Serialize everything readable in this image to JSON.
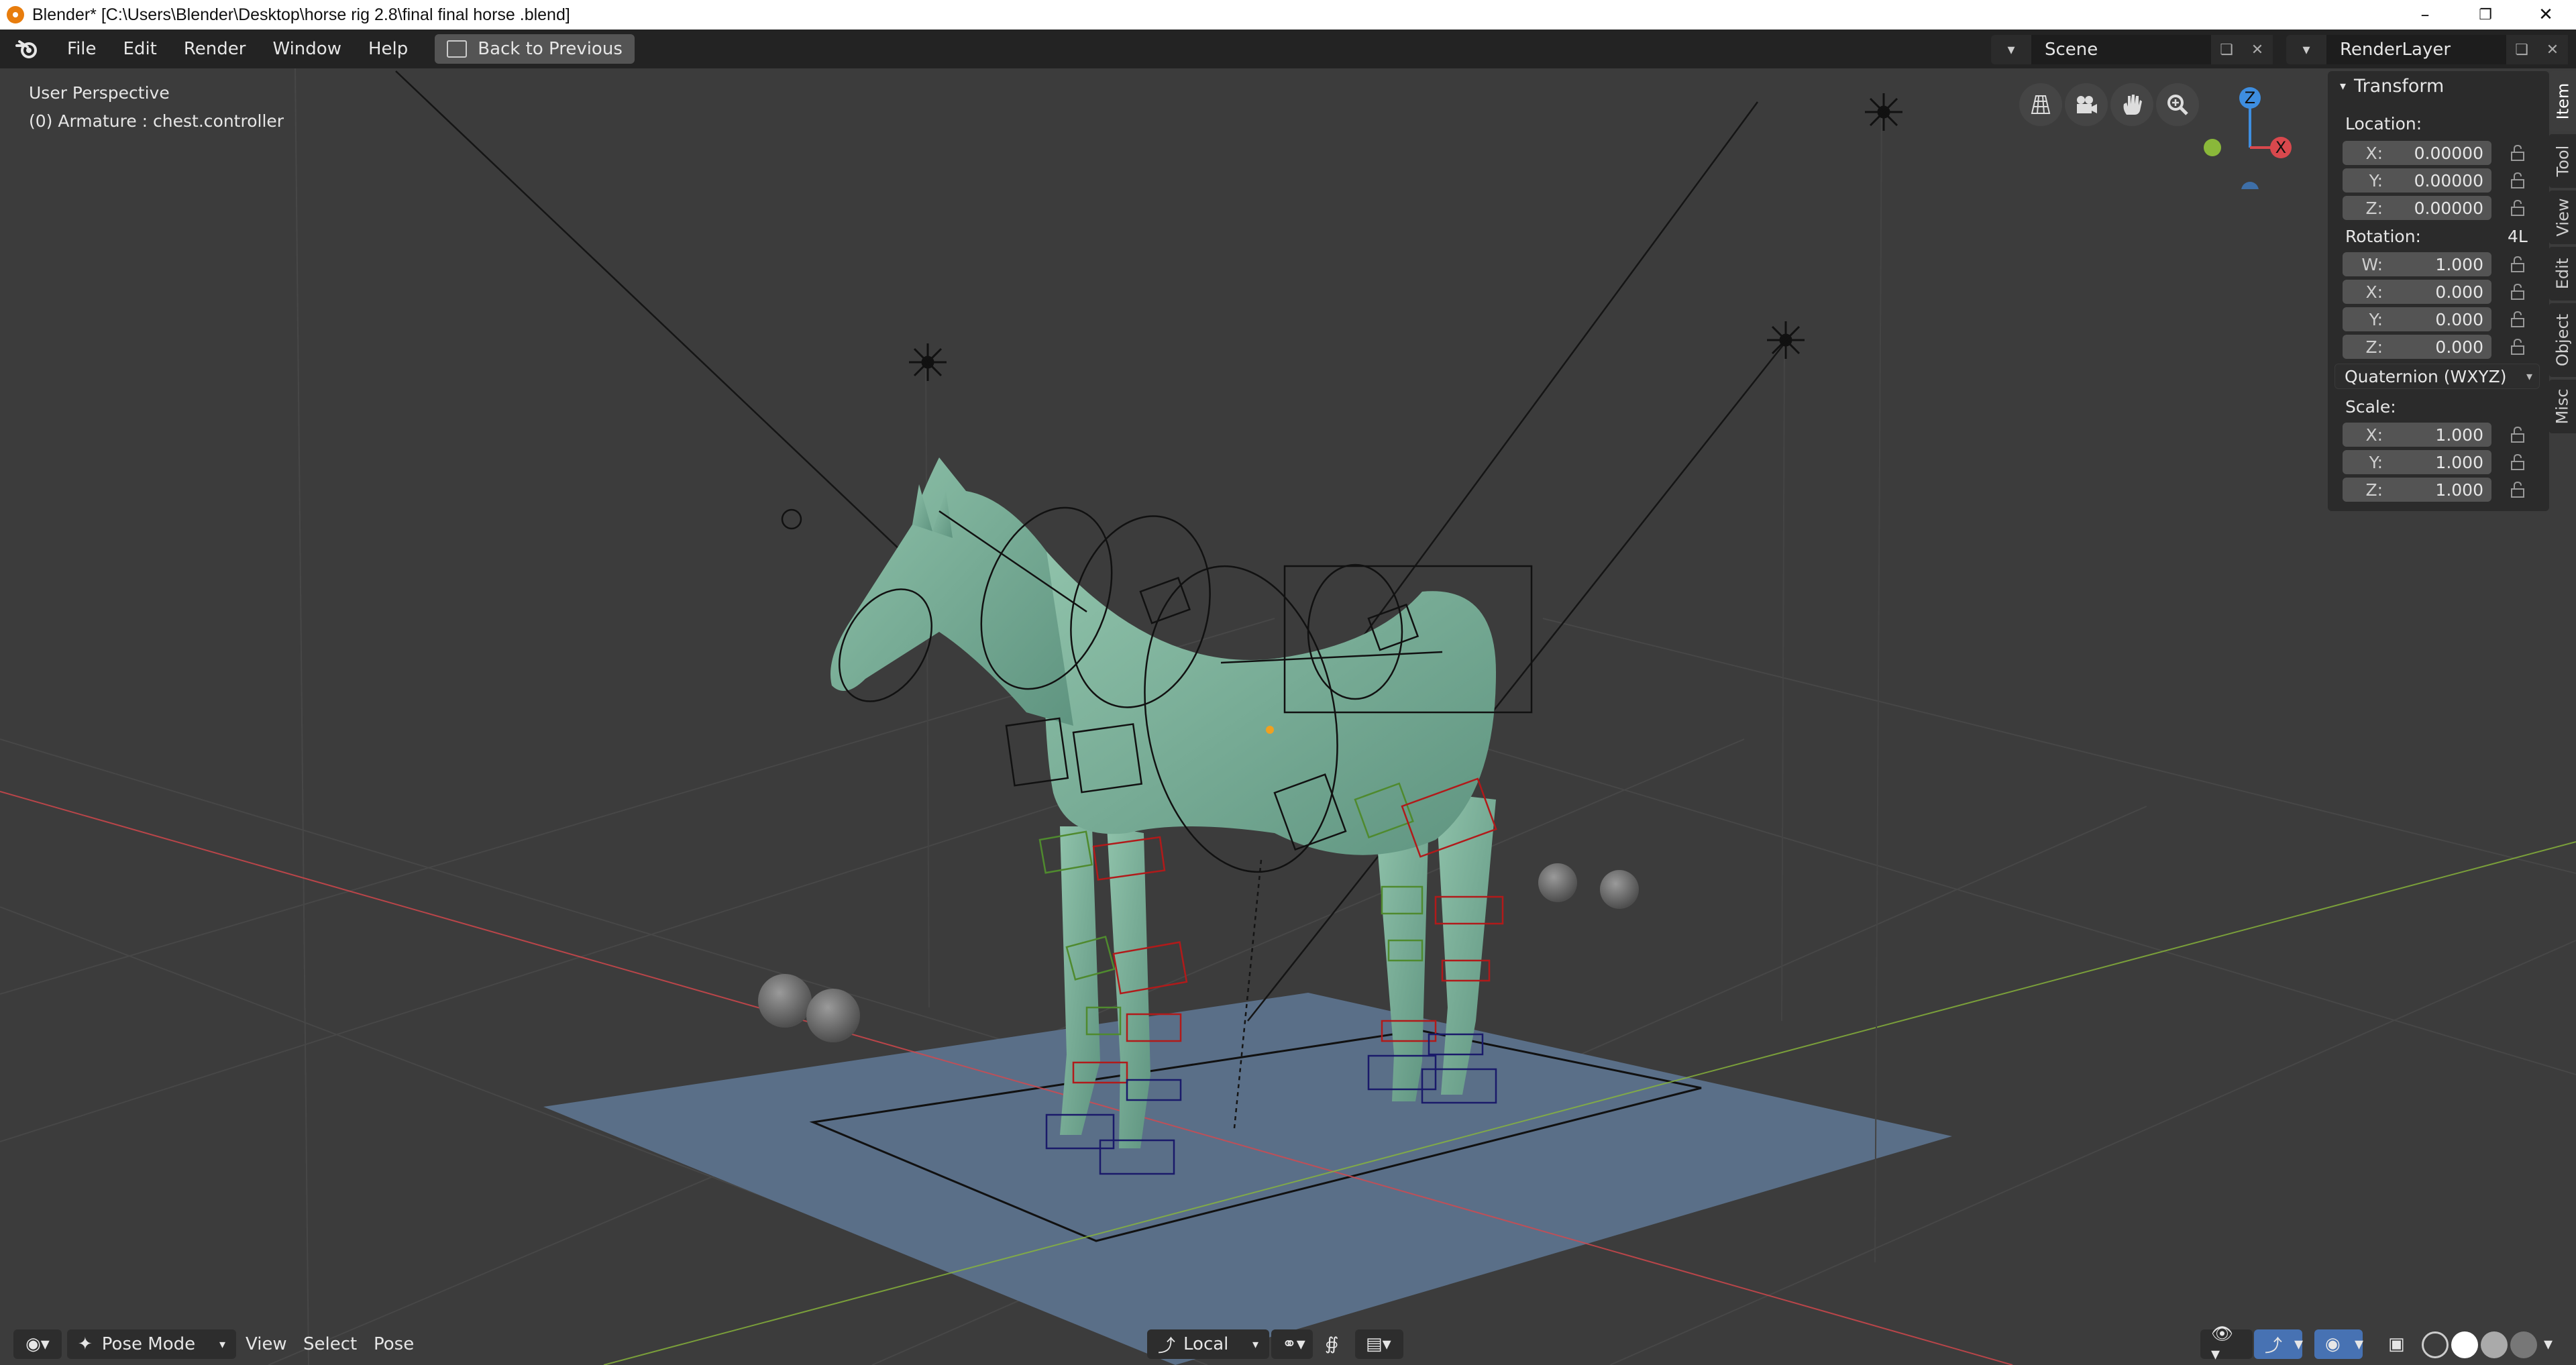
{
  "window": {
    "title": "Blender* [C:\\Users\\Blender\\Desktop\\horse rig 2.8\\final final horse .blend]",
    "minimize": "–",
    "maximize": "❐",
    "close": "✕"
  },
  "menu": {
    "file": "File",
    "edit": "Edit",
    "render": "Render",
    "window": "Window",
    "help": "Help",
    "back": "Back to Previous"
  },
  "scene": {
    "name": "Scene"
  },
  "view_layer": {
    "name": "RenderLayer"
  },
  "viewport": {
    "perspective": "User Perspective",
    "active_object": "(0) Armature : chest.controller",
    "gizmo": {
      "z": "Z",
      "x": "X"
    }
  },
  "npanel": {
    "title": "Transform",
    "location_label": "Location:",
    "location": [
      {
        "axis": "X:",
        "value": "0.00000"
      },
      {
        "axis": "Y:",
        "value": "0.00000"
      },
      {
        "axis": "Z:",
        "value": "0.00000"
      }
    ],
    "rotation_label": "Rotation:",
    "rotation_badge": "4L",
    "rotation": [
      {
        "axis": "W:",
        "value": "1.000"
      },
      {
        "axis": "X:",
        "value": "0.000"
      },
      {
        "axis": "Y:",
        "value": "0.000"
      },
      {
        "axis": "Z:",
        "value": "0.000"
      }
    ],
    "rotation_mode": "Quaternion (WXYZ)",
    "scale_label": "Scale:",
    "scale": [
      {
        "axis": "X:",
        "value": "1.000"
      },
      {
        "axis": "Y:",
        "value": "1.000"
      },
      {
        "axis": "Z:",
        "value": "1.000"
      }
    ],
    "tabs": [
      "Item",
      "Tool",
      "View",
      "Edit",
      "Object",
      "Misc"
    ]
  },
  "bottom": {
    "mode": "Pose Mode",
    "view": "View",
    "select": "Select",
    "pose": "Pose",
    "pivot": "Local"
  },
  "colors": {
    "horse": "#7fb09a",
    "floor": "#5a6f88",
    "x_axis": "#d9484d",
    "y_axis": "#8ab83a",
    "z_axis": "#3e8ee0",
    "bone_red": "#b11a1a",
    "bone_green": "#4f8a2e"
  }
}
